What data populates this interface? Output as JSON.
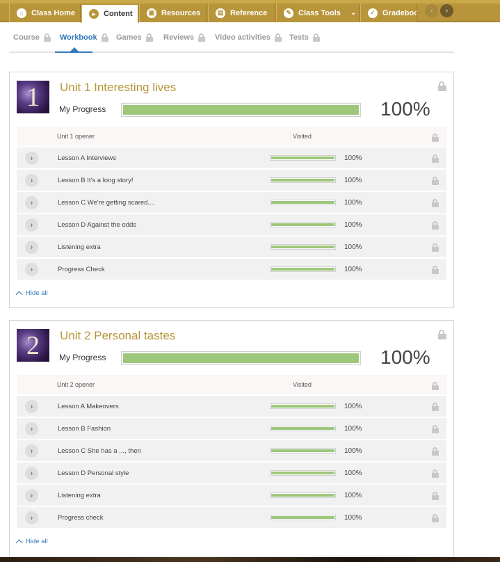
{
  "topnav": {
    "tabs": [
      {
        "label": "Class Home",
        "icon": "home-icon",
        "active": false
      },
      {
        "label": "Content",
        "icon": "content-icon",
        "active": true
      },
      {
        "label": "Resources",
        "icon": "resources-icon",
        "active": false
      },
      {
        "label": "Reference",
        "icon": "reference-icon",
        "active": false
      },
      {
        "label": "Class Tools",
        "icon": "tools-icon",
        "active": false
      },
      {
        "label": "Gradeboo",
        "icon": "gradebook-icon",
        "active": false
      }
    ],
    "prev_icon": "‹",
    "next_icon": "›"
  },
  "subtabs": [
    {
      "label": "Course",
      "active": false
    },
    {
      "label": "Workbook",
      "active": true
    },
    {
      "label": "Games",
      "active": false
    },
    {
      "label": "Reviews",
      "active": false
    },
    {
      "label": "Video activities",
      "active": false
    },
    {
      "label": "Tests",
      "active": false
    }
  ],
  "units": [
    {
      "number": "1",
      "title": "Unit 1 Interesting lives",
      "progress_label": "My Progress",
      "progress": 100,
      "progress_text": "100%",
      "table_header": {
        "name": "Unit 1 opener",
        "status": "Visited"
      },
      "lessons": [
        {
          "label": "Lesson A Interviews",
          "progress": 100,
          "pct": "100%"
        },
        {
          "label": "Lesson B It's a long story!",
          "progress": 100,
          "pct": "100%"
        },
        {
          "label": "Lesson C We're getting scared....",
          "progress": 100,
          "pct": "100%"
        },
        {
          "label": "Lesson D Against the odds",
          "progress": 100,
          "pct": "100%"
        },
        {
          "label": "Listening extra",
          "progress": 100,
          "pct": "100%"
        },
        {
          "label": "Progress Check",
          "progress": 100,
          "pct": "100%"
        }
      ],
      "hide_all": "Hide all"
    },
    {
      "number": "2",
      "title": "Unit 2 Personal tastes",
      "progress_label": "My Progress",
      "progress": 100,
      "progress_text": "100%",
      "table_header": {
        "name": "Unit 2 opener",
        "status": "Visited"
      },
      "lessons": [
        {
          "label": "Lesson A Makeovers",
          "progress": 100,
          "pct": "100%"
        },
        {
          "label": "Lesson B Fashion",
          "progress": 100,
          "pct": "100%"
        },
        {
          "label": "Lesson C She has a ..., then",
          "progress": 100,
          "pct": "100%"
        },
        {
          "label": "Lesson D Personal style",
          "progress": 100,
          "pct": "100%"
        },
        {
          "label": "Listening extra",
          "progress": 100,
          "pct": "100%"
        },
        {
          "label": "Progress check",
          "progress": 100,
          "pct": "100%"
        }
      ],
      "hide_all": "Hide all"
    }
  ],
  "colors": {
    "accent": "#b8953a",
    "link": "#3478b8",
    "progress_fill": "#9dc77a"
  }
}
